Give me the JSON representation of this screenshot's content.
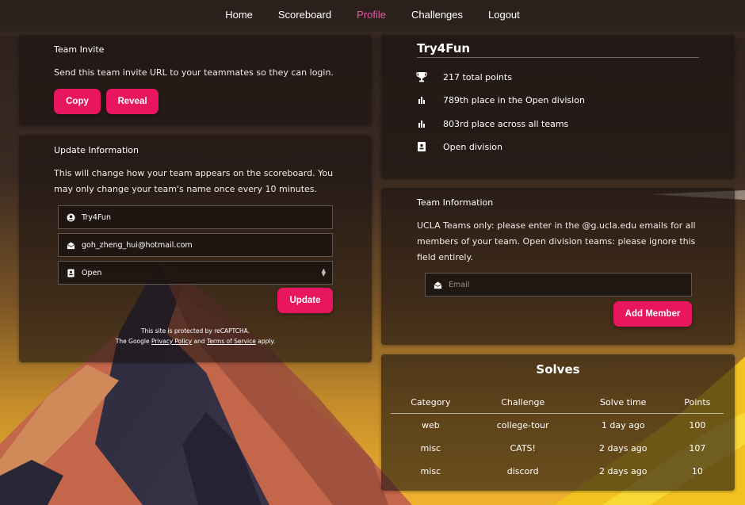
{
  "nav": {
    "items": [
      {
        "label": "Home",
        "active": false
      },
      {
        "label": "Scoreboard",
        "active": false
      },
      {
        "label": "Profile",
        "active": true
      },
      {
        "label": "Challenges",
        "active": false
      },
      {
        "label": "Logout",
        "active": false
      }
    ]
  },
  "team_invite": {
    "title": "Team Invite",
    "description": "Send this team invite URL to your teammates so they can login.",
    "copy_label": "Copy",
    "reveal_label": "Reveal"
  },
  "update_info": {
    "title": "Update Information",
    "description": "This will change how your team appears on the scoreboard. You may only change your team's name once every 10 minutes.",
    "name_value": "Try4Fun",
    "email_value": "goh_zheng_hui@hotmail.com",
    "division_value": "Open",
    "update_label": "Update",
    "recaptcha_line1": "This site is protected by reCAPTCHA.",
    "recaptcha_prefix": "The Google",
    "privacy_link": "Privacy Policy",
    "and_text": "and",
    "terms_link": "Terms of Service",
    "apply_text": "apply."
  },
  "profile": {
    "team_name": "Try4Fun",
    "points": "217 total points",
    "division_place": "789th place in the Open division",
    "overall_place": "803rd place across all teams",
    "division": "Open division"
  },
  "team_information": {
    "title": "Team Information",
    "description": "UCLA Teams only: please enter in the @g.ucla.edu emails for all members of your team. Open division teams: please ignore this field entirely.",
    "email_placeholder": "Email",
    "add_member_label": "Add Member"
  },
  "solves": {
    "title": "Solves",
    "headers": [
      "Category",
      "Challenge",
      "Solve time",
      "Points"
    ],
    "rows": [
      [
        "web",
        "college-tour",
        "1 day ago",
        "100"
      ],
      [
        "misc",
        "CATS!",
        "2 days ago",
        "107"
      ],
      [
        "misc",
        "discord",
        "2 days ago",
        "10"
      ]
    ]
  },
  "icons": {
    "points": "trophy-icon",
    "division_place": "bar-chart-icon",
    "overall_place": "bar-chart-icon",
    "division": "id-card-icon",
    "name_field": "user-circle-icon",
    "email_field": "envelope-open-icon",
    "division_field": "id-card-icon"
  },
  "colors": {
    "accent_button": "#e8155f",
    "active_nav": "#e35aa6",
    "card_bg": "rgba(28,20,17,0.62)"
  }
}
